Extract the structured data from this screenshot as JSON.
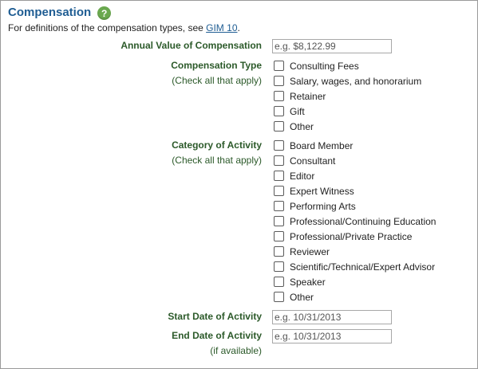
{
  "section": {
    "title": "Compensation",
    "help_icon": "question-mark-icon",
    "intro_text": "For definitions of the compensation types, see ",
    "intro_link": "GIM 10",
    "intro_end": "."
  },
  "annual_value": {
    "label": "Annual Value of Compensation",
    "placeholder": "e.g. $8,122.99"
  },
  "compensation_type": {
    "label": "Compensation Type",
    "hint": "(Check all that apply)",
    "options": [
      "Consulting Fees",
      "Salary, wages, and honorarium",
      "Retainer",
      "Gift",
      "Other"
    ]
  },
  "category_of_activity": {
    "label": "Category of Activity",
    "hint": "(Check all that apply)",
    "options": [
      "Board Member",
      "Consultant",
      "Editor",
      "Expert Witness",
      "Performing Arts",
      "Professional/Continuing Education",
      "Professional/Private Practice",
      "Reviewer",
      "Scientific/Technical/Expert Advisor",
      "Speaker",
      "Other"
    ]
  },
  "start_date": {
    "label": "Start Date of Activity",
    "placeholder": "e.g. 10/31/2013"
  },
  "end_date": {
    "label": "End Date of Activity",
    "hint": "(if available)",
    "placeholder": "e.g. 10/31/2013"
  }
}
